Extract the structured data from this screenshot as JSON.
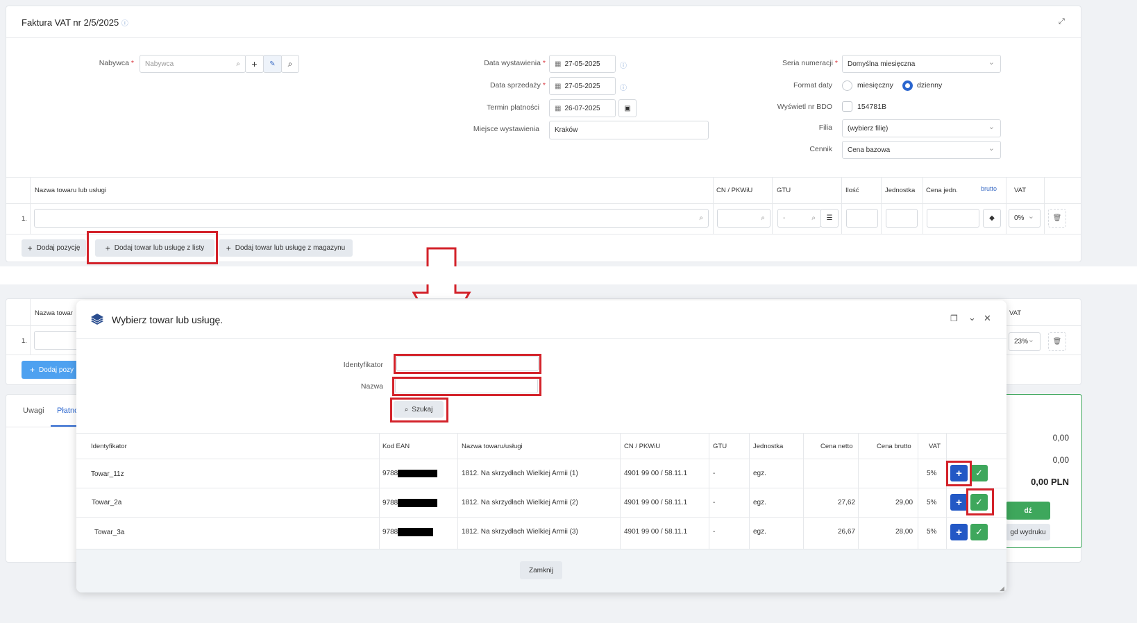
{
  "invoice": {
    "title": "Faktura VAT nr 2/5/2025",
    "buyer_label": "Nabywca",
    "buyer_placeholder": "Nabywca",
    "issue_date_label": "Data wystawienia",
    "issue_date": "27-05-2025",
    "sale_date_label": "Data sprzedaży",
    "sale_date": "27-05-2025",
    "payment_term_label": "Termin płatności",
    "payment_term": "26-07-2025",
    "place_label": "Miejsce wystawienia",
    "place": "Kraków",
    "series_label": "Seria numeracji",
    "series": "Domyślna miesięczna",
    "date_format_label": "Format daty",
    "date_format_monthly": "miesięczny",
    "date_format_daily": "dzienny",
    "bdo_label": "Wyświetl nr BDO",
    "bdo": "154781B",
    "branch_label": "Filia",
    "branch": "(wybierz filię)",
    "pricelist_label": "Cennik",
    "pricelist": "Cena bazowa"
  },
  "items_table": {
    "col_name": "Nazwa towaru lub usługi",
    "col_cn": "CN / PKWiU",
    "col_gtu": "GTU",
    "col_qty": "Ilość",
    "col_unit": "Jednostka",
    "col_price": "Cena jedn.",
    "col_brutto": "brutto",
    "col_vat": "VAT",
    "row_no": "1.",
    "gtu_value": "-",
    "vat_value": "0%",
    "btn_add_position": "Dodaj pozycję",
    "btn_add_from_list": "Dodaj towar lub usługę z listy",
    "btn_add_from_stock": "Dodaj towar lub usługę z magazynu"
  },
  "background": {
    "col_name": "Nazwa towar",
    "col_vat": "VAT",
    "row_no": "1.",
    "vat_value": "23%",
    "btn_add": "Dodaj pozy",
    "tab_notes": "Uwagi",
    "tab_payment": "Płatno",
    "sum1": "0,00",
    "sum2": "0,00",
    "total": "0,00 PLN",
    "btn_save": "dź",
    "btn_preview": "gd wydruku"
  },
  "modal": {
    "title": "Wybierz towar lub usługę.",
    "id_label": "Identyfikator",
    "name_label": "Nazwa",
    "search_btn": "Szukaj",
    "close_btn": "Zamknij",
    "columns": [
      "Identyfikator",
      "Kod EAN",
      "Nazwa towaru/usługi",
      "CN / PKWiU",
      "GTU",
      "Jednostka",
      "Cena netto",
      "Cena brutto",
      "VAT"
    ],
    "rows": [
      {
        "id": "Towar_11z",
        "ean": "9788",
        "name": "1812. Na skrzydłach Wielkiej Armii (1)",
        "cn": "4901 99 00 / 58.11.1",
        "gtu": "-",
        "unit": "egz.",
        "netto": "",
        "brutto": "",
        "vat": "5%"
      },
      {
        "id": "Towar_2a",
        "ean": "9788",
        "name": "1812. Na skrzydłach Wielkiej Armii (2)",
        "cn": "4901 99 00 / 58.11.1",
        "gtu": "-",
        "unit": "egz.",
        "netto": "27,62",
        "brutto": "29,00",
        "vat": "5%"
      },
      {
        "id": "Towar_3a",
        "ean": "9788",
        "name": "1812. Na skrzydłach Wielkiej Armii (3)",
        "cn": "4901 99 00 / 58.11.1",
        "gtu": "-",
        "unit": "egz.",
        "netto": "26,67",
        "brutto": "28,00",
        "vat": "5%"
      }
    ]
  },
  "colors": {
    "accent": "#2358c5",
    "success": "#3ea75c",
    "highlight": "#d3222a"
  }
}
